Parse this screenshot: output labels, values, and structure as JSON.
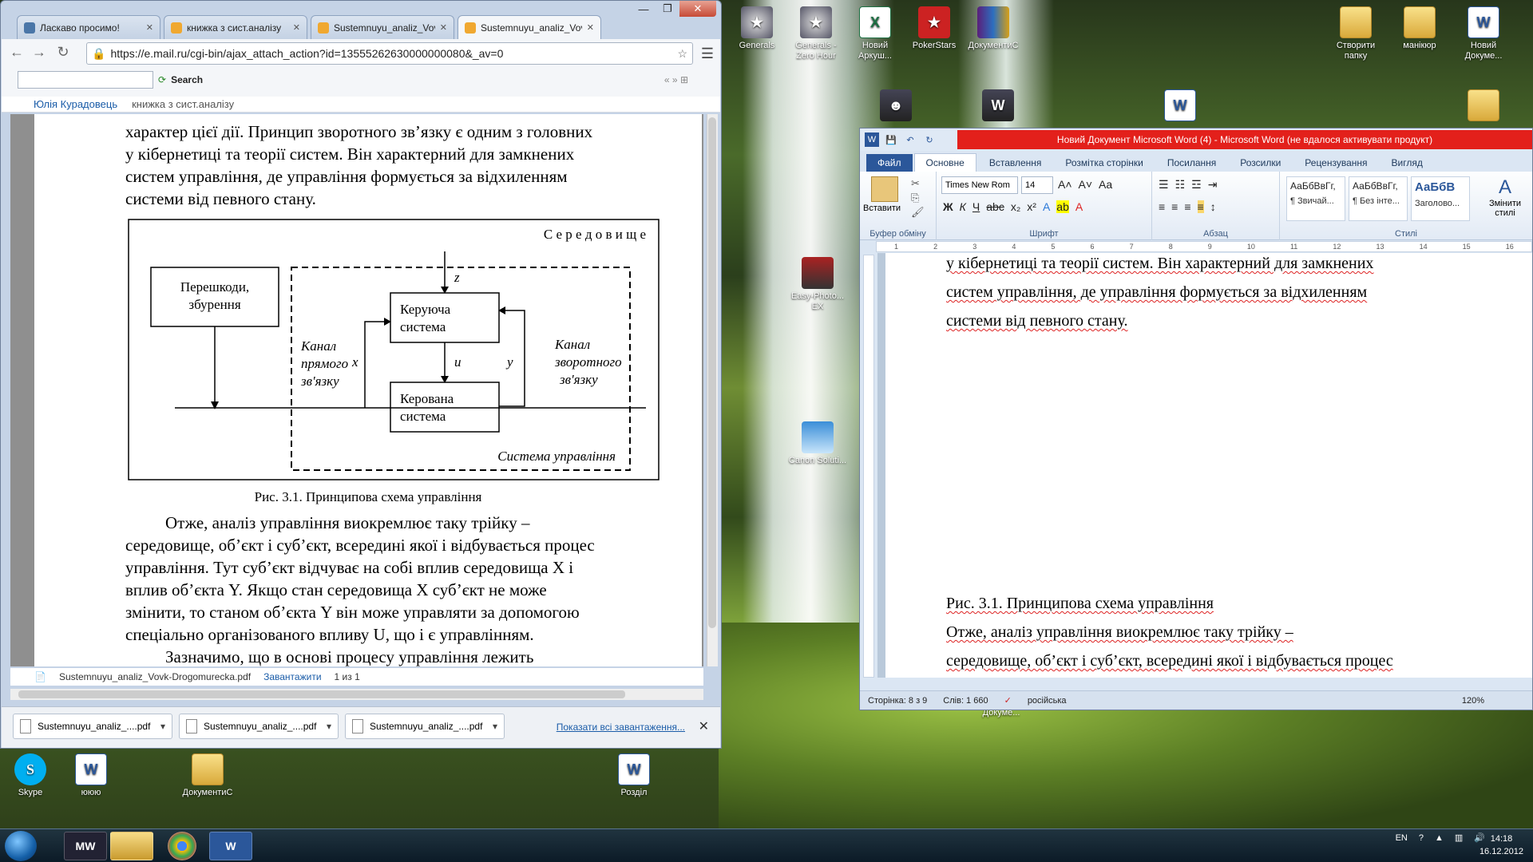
{
  "chrome": {
    "tabs": [
      {
        "label": "Ласкаво просимо!",
        "color": "#4a76a8"
      },
      {
        "label": "книжка з сист.аналізу",
        "color": "#f0a830"
      },
      {
        "label": "Sustemnuyu_analiz_Vov",
        "color": "#f0a830"
      },
      {
        "label": "Sustemnuyu_analiz_Vov",
        "color": "#f0a830"
      }
    ],
    "url": "https://e.mail.ru/cgi-bin/ajax_attach_action?id=13555262630000000080&_av=0",
    "search_label": "Search",
    "breadcrumb_user": "Юлія Курадовець",
    "breadcrumb_file": "книжка з сист.аналізу",
    "pdf_filename": "Sustemnuyu_analiz_Vovk-Drogomurecka.pdf",
    "download_label": "Завантажити",
    "page_counter": "1 из 1",
    "downloads": [
      "Sustemnuyu_analiz_....pdf",
      "Sustemnuyu_analiz_....pdf",
      "Sustemnuyu_analiz_....pdf"
    ],
    "show_all_downloads": "Показати всі завантаження..."
  },
  "pdf": {
    "para1": [
      "характер цієї дії. Принцип зворотного зв’язку є одним з головних",
      "у кібернетиці та теорії систем. Він характерний для замкнених",
      "систем управління, де управління формується за відхиленням",
      "системи від певного стану."
    ],
    "diagram": {
      "env": "С е р е д о в и щ е",
      "noise": [
        "Перешкоди,",
        "збурення"
      ],
      "control": [
        "Керуюча",
        "система"
      ],
      "controlled": [
        "Керована",
        "система"
      ],
      "direct": [
        "Канал",
        "прямого",
        "зв'язку"
      ],
      "feedback": [
        "Канал",
        "зворотного",
        "зв'язку"
      ],
      "z": "z",
      "x": "x",
      "u": "u",
      "y": "y",
      "system": "Система управління"
    },
    "caption": "Рис. 3.1. Принципова схема управління",
    "para2": [
      "Отже, аналіз управління виокремлює таку трійку –",
      "середовище, об’єкт і суб’єкт, всередині якої і відбувається процес",
      "управління. Тут суб’єкт відчуває на собі вплив середовища X і",
      "вплив об’єкта Y. Якщо стан середовища X суб’єкт не може",
      "змінити, то станом об’єкта Y він може управляти за допомогою",
      "спеціально організованого впливу U, що і є управлінням.",
      "Зазначимо, що в основі процесу управління лежить"
    ]
  },
  "word": {
    "title": "Новий Документ Microsoft Word (4)  -  Microsoft Word (не вдалося активувати продукт)",
    "tabs": [
      "Файл",
      "Основне",
      "Вставлення",
      "Розмітка сторінки",
      "Посилання",
      "Розсилки",
      "Рецензування",
      "Вигляд"
    ],
    "font_name": "Times New Rom",
    "font_size": "14",
    "paste_label": "Вставити",
    "groups": [
      "Буфер обміну",
      "Шрифт",
      "Абзац",
      "Стилі"
    ],
    "styles": [
      {
        "sample": "АаБбВвГг,",
        "name": "¶ Звичай..."
      },
      {
        "sample": "АаБбВвГг,",
        "name": "¶ Без інте..."
      },
      {
        "sample": "АаБбВ",
        "name": "Заголово..."
      }
    ],
    "change_styles": "Змінити стилі",
    "lines": [
      "у кібернетиці та теорії систем. Він характерний для замкнених",
      "систем управління, де управління формується за відхиленням",
      "системи від певного стану.",
      "Рис. 3.1. Принципова схема управління",
      "Отже, аналіз управління виокремлює таку трійку  –",
      "середовище, об’єкт і суб’єкт, всередині якої і відбувається  процес"
    ],
    "status_page": "Сторінка: 8 з 9",
    "status_words": "Слів: 1 660",
    "status_lang": "російська",
    "zoom": "120%"
  },
  "desktop": {
    "icons": [
      {
        "label": "Generals",
        "type": "gen"
      },
      {
        "label": "Generals - Zero Hour",
        "type": "gen"
      },
      {
        "label": "Новий Аркуш...",
        "type": "excel"
      },
      {
        "label": "PokerStars",
        "type": "poker"
      },
      {
        "label": "ДокументиС",
        "type": "rar"
      },
      {
        "label": "Створити папку",
        "type": "folder"
      },
      {
        "label": "манікюр",
        "type": "folder"
      },
      {
        "label": "Новий Докуме...",
        "type": "word"
      },
      {
        "label": "Easy-Photo... EX",
        "type": "photo"
      },
      {
        "label": "Canon Soluti...",
        "type": "canon"
      },
      {
        "label": "Новий Докуме...",
        "type": "word"
      },
      {
        "label": "Skype",
        "type": "skype"
      },
      {
        "label": "ююю",
        "type": "word"
      },
      {
        "label": "ДокументиС",
        "type": "folder"
      },
      {
        "label": "Розділ",
        "type": "word"
      }
    ]
  },
  "taskbar": {
    "lang": "EN",
    "time": "14:18",
    "date": "16.12.2012"
  }
}
